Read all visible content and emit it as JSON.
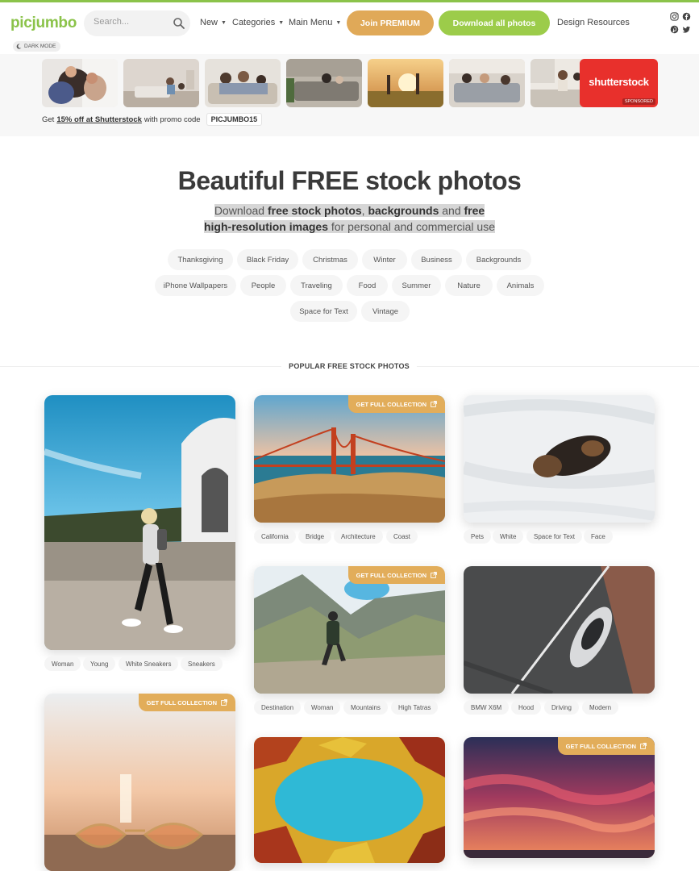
{
  "header": {
    "logo": "picjumbo",
    "search_placeholder": "Search...",
    "nav": {
      "new": "New",
      "categories": "Categories",
      "main_menu": "Main Menu",
      "design_resources": "Design Resources"
    },
    "premium_label": "Join PREMIUM",
    "download_label": "Download all photos",
    "dark_mode_label": "DARK MODE"
  },
  "sponsored_strip": {
    "shutterstock_logo": "shutterstock",
    "sponsored_label": "SPONSORED",
    "promo_prefix": "Get",
    "promo_link": "15% off at Shutterstock",
    "promo_middle": "with promo code",
    "promo_code": "PICJUMBO15"
  },
  "hero": {
    "title": "Beautiful FREE stock photos",
    "sub_1": "Download",
    "sub_2": "free stock photos",
    "sub_3": ",",
    "sub_4": "backgrounds",
    "sub_5": "and",
    "sub_6": "free high-resolution images",
    "sub_7": "for personal and commercial use"
  },
  "categories": [
    "Thanksgiving",
    "Black Friday",
    "Christmas",
    "Winter",
    "Business",
    "Backgrounds",
    "iPhone Wallpapers",
    "People",
    "Traveling",
    "Food",
    "Summer",
    "Nature",
    "Animals",
    "Space for Text",
    "Vintage"
  ],
  "section_title": "POPULAR FREE STOCK PHOTOS",
  "collection_label": "GET FULL COLLECTION",
  "photos": [
    {
      "tags": [
        "Woman",
        "Young",
        "White Sneakers",
        "Sneakers"
      ]
    },
    {
      "tags": [
        "California",
        "Bridge",
        "Architecture",
        "Coast"
      ]
    },
    {
      "tags": [
        "Pets",
        "White",
        "Space for Text",
        "Face"
      ]
    },
    {
      "tags": [
        "Destination",
        "Woman",
        "Mountains",
        "High Tatras"
      ]
    },
    {
      "tags": [
        "BMW X6M",
        "Hood",
        "Driving",
        "Modern"
      ]
    }
  ],
  "icons": {
    "search": "search-icon",
    "instagram": "instagram-icon",
    "facebook": "facebook-icon",
    "pinterest": "pinterest-icon",
    "twitter": "twitter-icon",
    "moon": "moon-icon",
    "external": "external-link-icon"
  },
  "colors": {
    "brand_green": "#8bc34a",
    "premium_orange": "#e0a958",
    "download_green": "#9ccc4a",
    "collection_badge": "#e2ad5a",
    "shutterstock_red": "#e8302c"
  }
}
